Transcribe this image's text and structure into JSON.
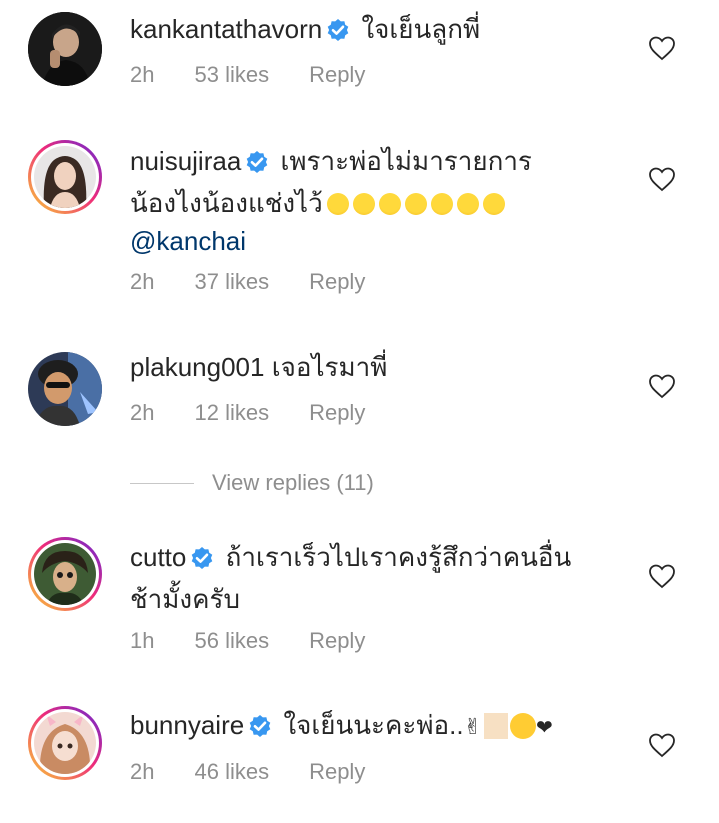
{
  "comments": [
    {
      "username": "kankantathavorn",
      "verified": true,
      "text": "ใจเย็นลูกพี่",
      "time": "2h",
      "likes": "53 likes",
      "reply": "Reply"
    },
    {
      "username": "nuisujiraa",
      "verified": true,
      "text_line1": "เพราะพ่อไม่มารายการ",
      "text_line2": "น้องไงน้องแช่งไว้",
      "mention": "@kanchai",
      "time": "2h",
      "likes": "37 likes",
      "reply": "Reply"
    },
    {
      "username": "plakung001",
      "verified": false,
      "text": "เจอไรมาพี่",
      "time": "2h",
      "likes": "12 likes",
      "reply": "Reply"
    },
    {
      "username": "cutto",
      "verified": true,
      "text_line1": "ถ้าเราเร็วไปเราคงรู้สึกว่าคนอื่น",
      "text_line2": "ช้ามั้งครับ",
      "time": "1h",
      "likes": "56 likes",
      "reply": "Reply"
    },
    {
      "username": "bunnyaire",
      "verified": true,
      "text": "ใจเย็นนะคะพ่อ..",
      "time": "2h",
      "likes": "46 likes",
      "reply": "Reply"
    }
  ],
  "view_replies": "View replies (11)",
  "colors": {
    "verified_blue": "#3897f0",
    "meta_gray": "#8e8e8e",
    "mention_blue": "#00376b"
  }
}
